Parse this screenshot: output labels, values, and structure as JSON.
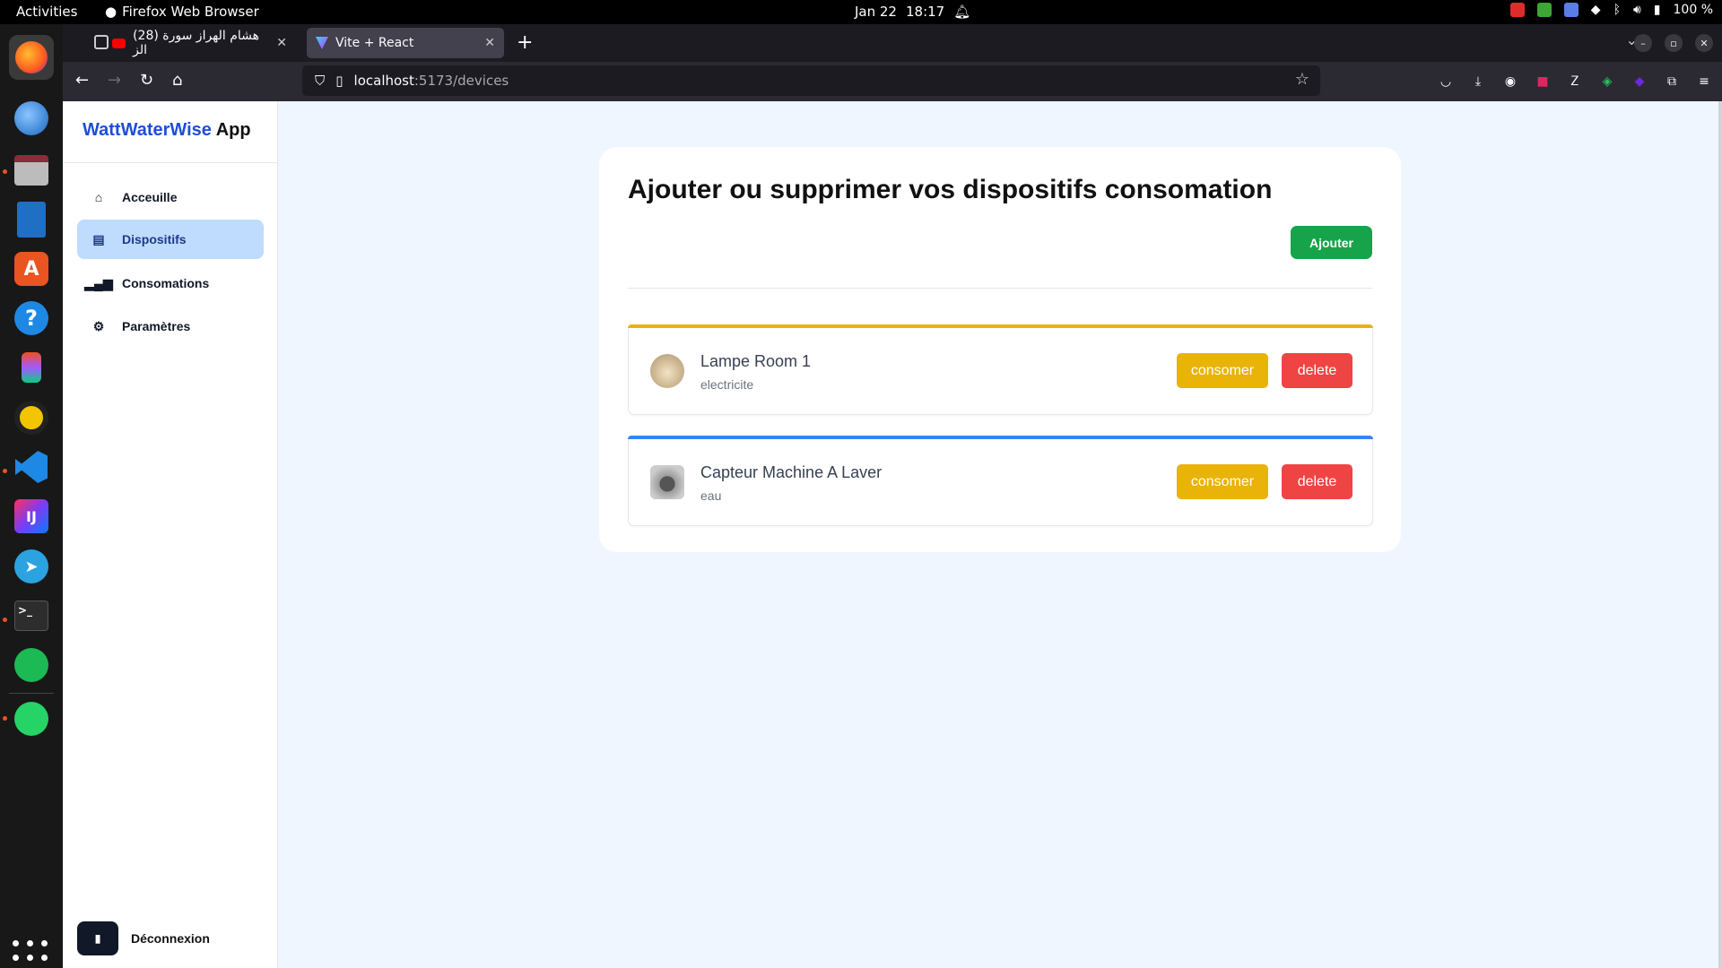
{
  "system": {
    "activities": "Activities",
    "app_name": "Firefox Web Browser",
    "date": "Jan 22",
    "time": "18:17",
    "battery": "100 %"
  },
  "browser": {
    "tabs": [
      {
        "label": "(28) هشام الهراز سورة الز",
        "icon": "youtube-icon",
        "active": false
      },
      {
        "label": "Vite + React",
        "icon": "vite-icon",
        "active": true
      }
    ],
    "url_host": "localhost",
    "url_path": ":5173/devices"
  },
  "app": {
    "brand_main": "WattWaterWise",
    "brand_suffix": " App",
    "nav": [
      {
        "label": "Acceuille",
        "icon": "home-icon",
        "active": false
      },
      {
        "label": "Dispositifs",
        "icon": "device-icon",
        "active": true
      },
      {
        "label": "Consomations",
        "icon": "bar-chart-icon",
        "active": false
      },
      {
        "label": "Paramètres",
        "icon": "gear-icon",
        "active": false
      }
    ],
    "logout_label": "Déconnexion"
  },
  "main": {
    "title": "Ajouter ou supprimer vos dispositifs consomation",
    "add_label": "Ajouter",
    "devices": [
      {
        "name": "Lampe Room 1",
        "type": "electricite",
        "accent": "#eab308",
        "consume_label": "consomer",
        "delete_label": "delete"
      },
      {
        "name": "Capteur Machine A Laver",
        "type": "eau",
        "accent": "#3b82f6",
        "consume_label": "consomer",
        "delete_label": "delete"
      }
    ]
  },
  "colors": {
    "brand_blue": "#1d4ed8",
    "add_green": "#16a34a",
    "consume_yellow": "#eab308",
    "delete_red": "#ef4444",
    "active_nav_bg": "#bfdbfe"
  }
}
